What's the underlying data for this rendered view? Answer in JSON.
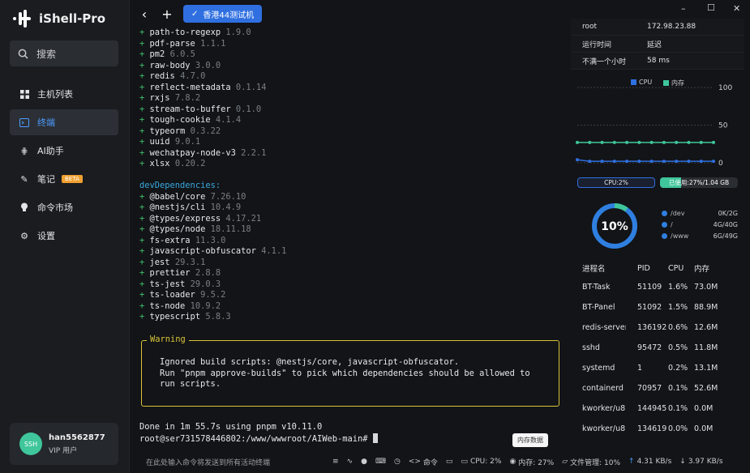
{
  "app": {
    "name": "iShell-Pro"
  },
  "search": {
    "placeholder": "搜索"
  },
  "sidebar": {
    "items": [
      {
        "label": "主机列表",
        "icon": "grid-icon"
      },
      {
        "label": "终端",
        "icon": "terminal-icon"
      },
      {
        "label": "AI助手",
        "icon": "ai-icon"
      },
      {
        "label": "笔记",
        "icon": "note-icon",
        "badge": "BETA"
      },
      {
        "label": "命令市场",
        "icon": "bulb-icon"
      },
      {
        "label": "设置",
        "icon": "gear-icon"
      }
    ]
  },
  "user": {
    "avatar": "SSH",
    "name": "han5562877",
    "role": "VIP 用户"
  },
  "tab": {
    "label": "香港44测试机"
  },
  "terminal": {
    "deps": [
      {
        "name": "path-to-regexp",
        "ver": "1.9.0"
      },
      {
        "name": "pdf-parse",
        "ver": "1.1.1"
      },
      {
        "name": "pm2",
        "ver": "6.0.5"
      },
      {
        "name": "raw-body",
        "ver": "3.0.0"
      },
      {
        "name": "redis",
        "ver": "4.7.0"
      },
      {
        "name": "reflect-metadata",
        "ver": "0.1.14"
      },
      {
        "name": "rxjs",
        "ver": "7.8.2"
      },
      {
        "name": "stream-to-buffer",
        "ver": "0.1.0"
      },
      {
        "name": "tough-cookie",
        "ver": "4.1.4"
      },
      {
        "name": "typeorm",
        "ver": "0.3.22"
      },
      {
        "name": "uuid",
        "ver": "9.0.1"
      },
      {
        "name": "wechatpay-node-v3",
        "ver": "2.2.1"
      },
      {
        "name": "xlsx",
        "ver": "0.20.2"
      }
    ],
    "dev_header": "devDependencies:",
    "dev_deps": [
      {
        "name": "@babel/core",
        "ver": "7.26.10"
      },
      {
        "name": "@nestjs/cli",
        "ver": "10.4.9"
      },
      {
        "name": "@types/express",
        "ver": "4.17.21"
      },
      {
        "name": "@types/node",
        "ver": "18.11.18"
      },
      {
        "name": "fs-extra",
        "ver": "11.3.0"
      },
      {
        "name": "javascript-obfuscator",
        "ver": "4.1.1"
      },
      {
        "name": "jest",
        "ver": "29.3.1"
      },
      {
        "name": "prettier",
        "ver": "2.8.8"
      },
      {
        "name": "ts-jest",
        "ver": "29.0.3"
      },
      {
        "name": "ts-loader",
        "ver": "9.5.2"
      },
      {
        "name": "ts-node",
        "ver": "10.9.2"
      },
      {
        "name": "typescript",
        "ver": "5.8.3"
      }
    ],
    "warning_title": "Warning",
    "warning_lines": [
      "Ignored build scripts: @nestjs/core, javascript-obfuscator.",
      "Run \"pnpm approve-builds\" to pick which dependencies should be allowed to",
      "run scripts."
    ],
    "done_line": "Done in 1m 55.7s using pnpm v10.11.0",
    "prompt": "root@ser731578446802:/www/wwwroot/AIWeb-main# "
  },
  "tooltip": "内存数据",
  "server": {
    "rows": [
      {
        "k": "root",
        "v": "172.98.23.88"
      },
      {
        "k": "运行时间",
        "v": "延迟"
      },
      {
        "k": "不满一个小时",
        "v": "58 ms"
      }
    ]
  },
  "chart_data": {
    "type": "line",
    "series": [
      {
        "name": "CPU",
        "color": "#2f6fe0",
        "values": [
          4,
          2,
          2,
          2,
          2,
          2,
          2,
          2,
          2,
          2,
          2,
          2
        ]
      },
      {
        "name": "内存",
        "color": "#3fc69a",
        "values": [
          27,
          27,
          27,
          27,
          27,
          27,
          27,
          27,
          27,
          27,
          27,
          27
        ]
      }
    ],
    "ylim": [
      0,
      100
    ],
    "yticks": [
      "100",
      "50",
      "0"
    ]
  },
  "cpu_bar": {
    "label": "CPU:2%",
    "value": 2
  },
  "mem_bar": {
    "label": "已使用:27%/1.04 GB",
    "value": 27
  },
  "gauge": {
    "label": "10%",
    "value": 10
  },
  "disks": [
    {
      "path": "/dev",
      "usage": "0K/2G"
    },
    {
      "path": "/",
      "usage": "4G/40G"
    },
    {
      "path": "/www",
      "usage": "6G/49G"
    }
  ],
  "processes": {
    "headers": [
      "进程名",
      "PID",
      "CPU",
      "内存"
    ],
    "rows": [
      [
        "BT-Task",
        "51109",
        "1.6%",
        "73.0M"
      ],
      [
        "BT-Panel",
        "51092",
        "1.5%",
        "88.9M"
      ],
      [
        "redis-server",
        "136192",
        "0.6%",
        "12.6M"
      ],
      [
        "sshd",
        "95472",
        "0.5%",
        "11.8M"
      ],
      [
        "systemd",
        "1",
        "0.2%",
        "13.1M"
      ],
      [
        "containerd",
        "70957",
        "0.1%",
        "52.6M"
      ],
      [
        "kworker/u8:...",
        "144945",
        "0.1%",
        "0.0M"
      ],
      [
        "kworker/u8:...",
        "134619",
        "0.0%",
        "0.0M"
      ]
    ]
  },
  "bottom": {
    "input_placeholder": "在此处输入命令将发送到所有活动终端",
    "cmd_label": "命令",
    "cpu": "CPU: 2%",
    "mem": "内存: 27%",
    "file_mgr": "文件管理: 10%",
    "up": "4.31 KB/s",
    "down": "3.97 KB/s"
  }
}
